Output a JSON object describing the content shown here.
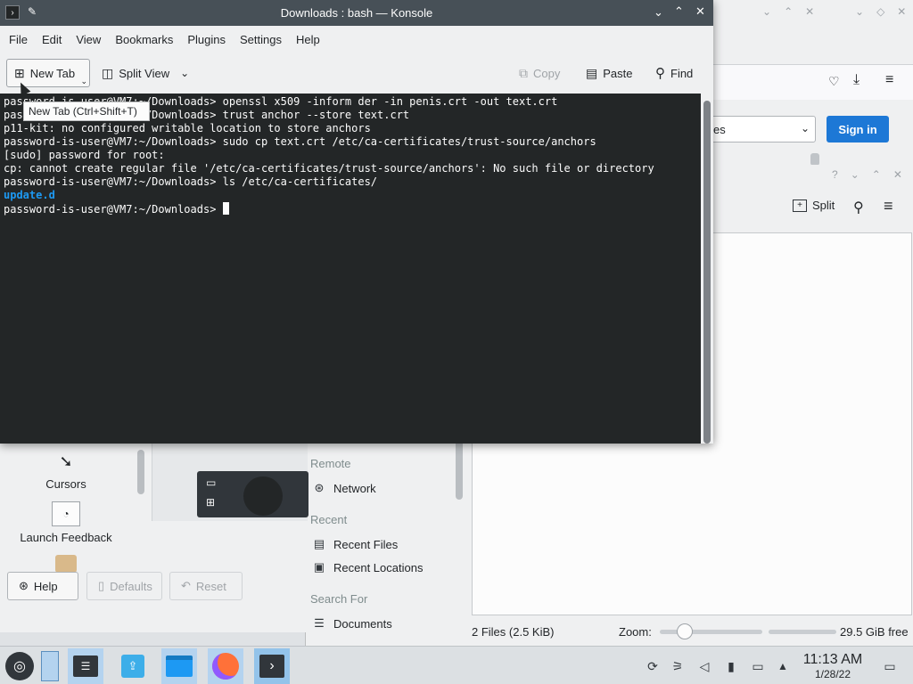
{
  "konsole": {
    "title": "Downloads : bash — Konsole",
    "menus": [
      "File",
      "Edit",
      "View",
      "Bookmarks",
      "Plugins",
      "Settings",
      "Help"
    ],
    "toolbar": {
      "new_tab": "New Tab",
      "split_view": "Split View",
      "copy": "Copy",
      "paste": "Paste",
      "find": "Find"
    },
    "tooltip": "New Tab (Ctrl+Shift+T)",
    "terminal": {
      "lines": [
        "password-is-user@VM7:~/Downloads> openssl x509 -inform der -in penis.crt -out text.crt",
        "password-is-user@VM7:~/Downloads> trust anchor --store text.crt",
        "p11-kit: no configured writable location to store anchors",
        "password-is-user@VM7:~/Downloads> sudo cp text.crt /etc/ca-certificates/trust-source/anchors",
        "[sudo] password for root:",
        "cp: cannot create regular file '/etc/ca-certificates/trust-source/anchors': No such file or directory",
        "password-is-user@VM7:~/Downloads> ls /etc/ca-certificates/"
      ],
      "dir_entry": "update.d",
      "prompt": "password-is-user@VM7:~/Downloads> "
    }
  },
  "browser": {
    "sign_in": "Sign in",
    "dropdown_value": "es"
  },
  "settings": {
    "items": [
      "Cursors",
      "Launch Feedback"
    ],
    "buttons": {
      "help": "Help",
      "defaults": "Defaults",
      "reset": "Reset"
    }
  },
  "dolphin": {
    "split": "Split",
    "places": {
      "remote_header": "Remote",
      "network": "Network",
      "recent_header": "Recent",
      "recent_files": "Recent Files",
      "recent_locations": "Recent Locations",
      "search_header": "Search For",
      "documents": "Documents"
    },
    "status": {
      "files": "2 Files (2.5 KiB)",
      "zoom_label": "Zoom:",
      "free": "29.5 GiB free",
      "zoom_level": 0.2
    }
  },
  "taskbar": {
    "time": "11:13 AM",
    "date": "1/28/22"
  }
}
